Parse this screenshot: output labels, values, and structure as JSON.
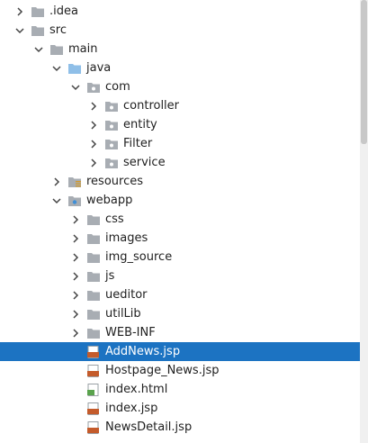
{
  "tree": {
    "items": [
      {
        "label": ".idea",
        "arrow": "right",
        "icon": "folder-icon"
      },
      {
        "label": "src",
        "arrow": "down",
        "icon": "folder-icon"
      },
      {
        "label": "main",
        "arrow": "down",
        "icon": "folder-icon"
      },
      {
        "label": "java",
        "arrow": "down",
        "icon": "source-folder-icon"
      },
      {
        "label": "com",
        "arrow": "down",
        "icon": "package-icon"
      },
      {
        "label": "controller",
        "arrow": "right",
        "icon": "package-icon"
      },
      {
        "label": "entity",
        "arrow": "right",
        "icon": "package-icon"
      },
      {
        "label": "Filter",
        "arrow": "right",
        "icon": "package-icon"
      },
      {
        "label": "service",
        "arrow": "right",
        "icon": "package-icon"
      },
      {
        "label": "resources",
        "arrow": "right",
        "icon": "resources-folder-icon"
      },
      {
        "label": "webapp",
        "arrow": "down",
        "icon": "web-folder-icon"
      },
      {
        "label": "css",
        "arrow": "right",
        "icon": "folder-icon"
      },
      {
        "label": "images",
        "arrow": "right",
        "icon": "folder-icon"
      },
      {
        "label": "img_source",
        "arrow": "right",
        "icon": "folder-icon"
      },
      {
        "label": "js",
        "arrow": "right",
        "icon": "folder-icon"
      },
      {
        "label": "ueditor",
        "arrow": "right",
        "icon": "folder-icon"
      },
      {
        "label": "utilLib",
        "arrow": "right",
        "icon": "folder-icon"
      },
      {
        "label": "WEB-INF",
        "arrow": "right",
        "icon": "folder-icon"
      },
      {
        "label": "AddNews.jsp",
        "arrow": "none",
        "icon": "jsp-file-icon",
        "selected": true
      },
      {
        "label": "Hostpage_News.jsp",
        "arrow": "none",
        "icon": "jsp-file-icon"
      },
      {
        "label": "index.html",
        "arrow": "none",
        "icon": "html-file-icon"
      },
      {
        "label": "index.jsp",
        "arrow": "none",
        "icon": "jsp-file-icon"
      },
      {
        "label": "NewsDetail.jsp",
        "arrow": "none",
        "icon": "jsp-file-icon"
      }
    ]
  },
  "colors": {
    "folder": "#a8adb3",
    "source_folder": "#8fbfe8",
    "selection": "#1c73c2",
    "jsp": "#c45b2b",
    "html": "#5aa34d"
  }
}
